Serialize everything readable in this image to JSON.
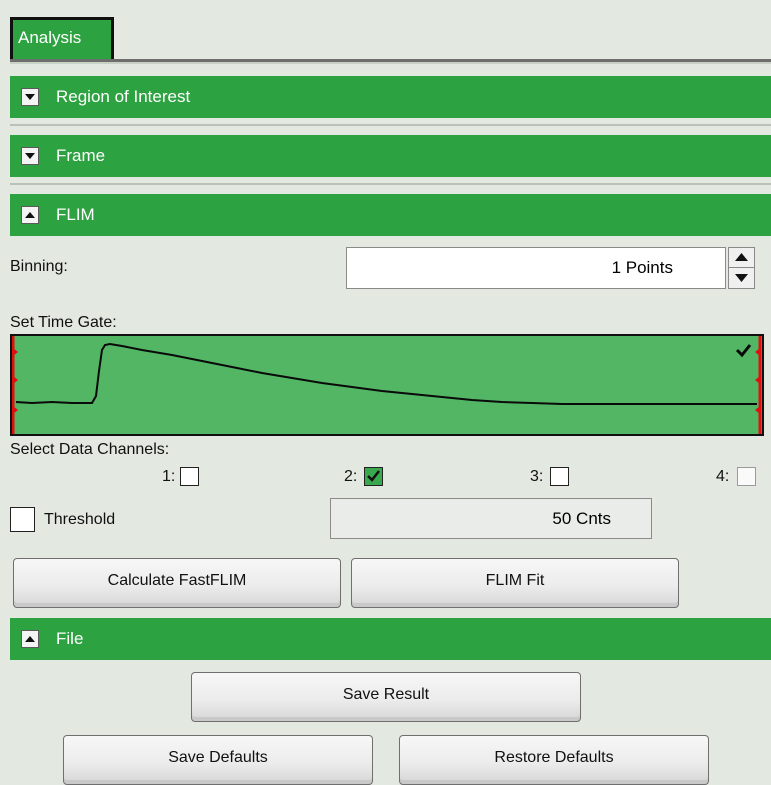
{
  "tab": {
    "label": "Analysis"
  },
  "sections": {
    "roi": {
      "title": "Region of Interest"
    },
    "frame": {
      "title": "Frame"
    },
    "flim": {
      "title": "FLIM"
    },
    "file": {
      "title": "File"
    }
  },
  "flim": {
    "binning_label": "Binning:",
    "binning_value": "1 Points",
    "time_gate_label": "Set Time Gate:",
    "channels_label": "Select Data Channels:",
    "channels": [
      {
        "label": "1:",
        "checked": false
      },
      {
        "label": "2:",
        "checked": true
      },
      {
        "label": "3:",
        "checked": false
      },
      {
        "label": "4:",
        "checked": false
      }
    ],
    "threshold_label": "Threshold",
    "threshold_checked": false,
    "threshold_value": "50 Cnts",
    "calc_button": "Calculate FastFLIM",
    "fit_button": "FLIM Fit"
  },
  "file": {
    "save_result": "Save Result",
    "save_defaults": "Save Defaults",
    "restore_defaults": "Restore Defaults"
  },
  "colors": {
    "accent": "#2da240",
    "plot_bg": "#52b665",
    "gate_marker": "#e01010"
  },
  "icons": [
    "collapse-triangle-icon",
    "expand-triangle-icon",
    "spin-up-icon",
    "spin-down-icon",
    "checkmark-icon"
  ]
}
